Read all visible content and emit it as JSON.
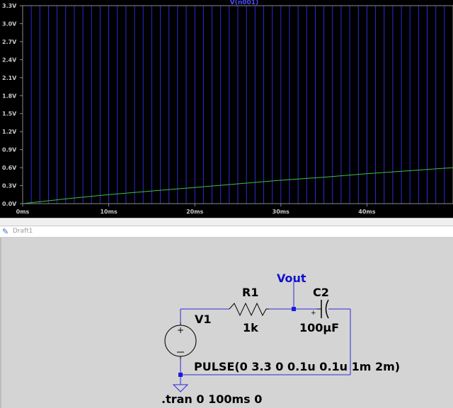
{
  "chart_data": {
    "type": "line",
    "title": "V(n001)",
    "xlabel": "",
    "ylabel": "",
    "xlim": [
      0,
      50
    ],
    "ylim": [
      0,
      3.3
    ],
    "x_ticks": [
      0,
      10,
      20,
      30,
      40
    ],
    "x_tick_labels": [
      "0ms",
      "10ms",
      "20ms",
      "30ms",
      "40ms"
    ],
    "y_ticks": [
      0,
      0.3,
      0.6,
      0.9,
      1.2,
      1.5,
      1.8,
      2.1,
      2.4,
      2.7,
      3.0,
      3.3
    ],
    "y_tick_labels": [
      "0.0V",
      "0.3V",
      "0.6V",
      "0.9V",
      "1.2V",
      "1.5V",
      "1.8V",
      "2.1V",
      "2.4V",
      "2.7V",
      "3.0V",
      "3.3V"
    ],
    "grid": false,
    "series": [
      {
        "name": "V(n001)",
        "color": "#2a2adc",
        "waveform": "pulse",
        "period_ms": 2,
        "high_ms": 1,
        "low_v": 0,
        "high_v": 3.3
      },
      {
        "name": "",
        "color": "#3fbf3f",
        "x": [
          0,
          5,
          10,
          15,
          20,
          25,
          30,
          35,
          40,
          45,
          50
        ],
        "y": [
          0.0,
          0.08,
          0.15,
          0.21,
          0.27,
          0.33,
          0.39,
          0.44,
          0.5,
          0.55,
          0.6
        ]
      }
    ]
  },
  "draft_tab": {
    "icon": "schematic-icon",
    "label": "Draft1"
  },
  "schematic": {
    "net_label": "Vout",
    "r1_name": "R1",
    "r1_value": "1k",
    "c2_name": "C2",
    "c2_value": "100µF",
    "v1_name": "V1",
    "v1_value": "PULSE(0 3.3 0 0.1u 0.1u 1m 2m)",
    "directive": ".tran 0 100ms 0",
    "wire_color": "#2a2adc",
    "net_color": "#1010cc"
  }
}
